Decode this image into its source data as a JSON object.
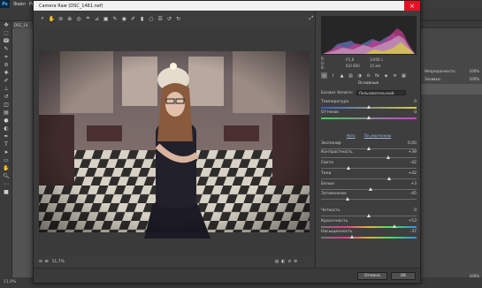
{
  "photoshop": {
    "logo": "Ps",
    "menu": [
      "Файл",
      "Ред"
    ],
    "doc_tab": "DSC_14",
    "status_left": "11,9%",
    "right_panel": {
      "rows": [
        {
          "label": "",
          "value": "100%"
        },
        {
          "label": "",
          "value": "100%"
        }
      ],
      "layer_label": "Непрозрачность:",
      "layer_value": "100%",
      "fill_label": "Заливка:",
      "fill_value": "100%",
      "bottom_value": "100%"
    }
  },
  "camera_raw": {
    "title": "Camera Raw (DSC_1461.nef)",
    "zoom": "11,7%",
    "histogram_info": {
      "left_lines": [
        "R:",
        "G:",
        "B:"
      ],
      "aperture": "f/1,8",
      "shutter": "1/400 с",
      "iso": "ISO 800",
      "focal": "35 мм"
    },
    "panel_title": "Основные",
    "white_balance_label": "Баланс белого:",
    "white_balance_value": "Пользовательский",
    "auto_label": "Авто",
    "default_label": "По умолчанию",
    "sliders": [
      {
        "name": "temperature",
        "label": "Температура",
        "value": "0",
        "pos": 0.5,
        "gradient": "linear-gradient(90deg,#3b5bd6,#d6cf3b)"
      },
      {
        "name": "tint",
        "label": "Оттенок",
        "value": "0",
        "pos": 0.5,
        "gradient": "linear-gradient(90deg,#3bd65b,#d63bd1)"
      },
      {
        "name": "exposure",
        "label": "Экспонир",
        "value": "0,00",
        "pos": 0.5,
        "gradient": ""
      },
      {
        "name": "contrast",
        "label": "Контрастность",
        "value": "+39",
        "pos": 0.7,
        "gradient": ""
      },
      {
        "name": "highlights",
        "label": "Света",
        "value": "-42",
        "pos": 0.29,
        "gradient": ""
      },
      {
        "name": "shadows",
        "label": "Тени",
        "value": "+42",
        "pos": 0.71,
        "gradient": ""
      },
      {
        "name": "whites",
        "label": "Белые",
        "value": "+3",
        "pos": 0.52,
        "gradient": ""
      },
      {
        "name": "blacks",
        "label": "Затемнение",
        "value": "-45",
        "pos": 0.28,
        "gradient": ""
      },
      {
        "name": "clarity",
        "label": "Четкость",
        "value": "0",
        "pos": 0.5,
        "gradient": ""
      },
      {
        "name": "vibrance",
        "label": "Красочность",
        "value": "+53",
        "pos": 0.77,
        "gradient": "linear-gradient(90deg,#777,#e03b8c,#e0b13b,#3be06a,#3b8ce0)"
      },
      {
        "name": "saturation",
        "label": "Насыщенность",
        "value": "-37",
        "pos": 0.32,
        "gradient": "linear-gradient(90deg,#777,#e03b8c,#e0b13b,#3be06a,#3b8ce0)"
      }
    ],
    "buttons": {
      "cancel": "Отмена",
      "ok": "OK"
    }
  },
  "colors": {
    "dialog_bg": "#434343",
    "close_button": "#e81123"
  }
}
